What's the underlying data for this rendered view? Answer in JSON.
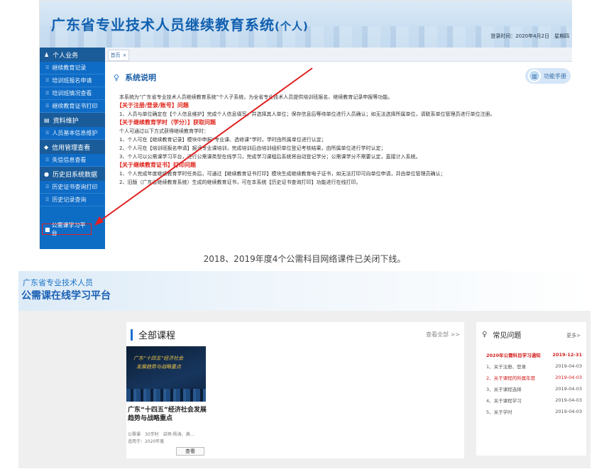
{
  "top": {
    "system_title_main": "广东省专业技术人员继续教育系统",
    "system_title_sub": "(个人)",
    "login_time": "登录时间：2020年4月2日　星期四",
    "sidebar": {
      "groups": [
        {
          "title": "个人业务",
          "items": [
            "继续教育记录",
            "培训班报名申请",
            "培训班情况查看",
            "继续教育证书打印"
          ]
        },
        {
          "title": "资料维护",
          "items": [
            "人员基本信息维护"
          ]
        },
        {
          "title": "信用管理查看",
          "items": [
            "失信信息查看"
          ]
        },
        {
          "title": "历史旧系统数据",
          "items": [
            "历史证书查询打印",
            "历史记录查询"
          ]
        }
      ],
      "highlighted_item": "公需课学习平台"
    },
    "tab_home": "首页",
    "tab_close": "×",
    "content_title": "系统说明",
    "manual_button": "功能手册",
    "intro": "本系统为“广东省专业技术人员继续教育系统”个人子系统，为全省专业技术人员提供培训班报名、继续教育记录申报等功能。",
    "sections": [
      {
        "title": "【关于注册/登录/账号】问题",
        "lines": [
          "1、人员与单位确定在【个人信息维护】完成个人信息填写，并选择其人单位；保存信息后等待单位进行人员确认；如无法选择所属单位，请联系单位管理员进行单位注册。"
        ]
      },
      {
        "title": "【关于继续教育学时（学分）】获取问题",
        "lines": [
          "个人可通过以下方式获得继续教育学时：",
          "1、个人可在【继续教育记录】模块中申报“专业课、选修课”学时，学时由所属单位进行认定；",
          "2、个人可在【培训班报名申请】报读专业课培训，完成培训后由培训组织单位登记考核结果，由所属单位进行学时认定；",
          "3、个人可以公需课学习平台，进行公需课类型在线学习，完成学习课程后系统将自动登记学分；公需课学分不需要认定，直接计入系统。"
        ]
      },
      {
        "title": "【关于继续教育证书】打印问题",
        "lines": [
          "1、个人完成年度继续教育学时任务后，可通过【继续教育证书打印】模块生成继续教育电子证书，如无法打印可向单位申请，并由单位管理员确认；",
          "2、旧版（广东省继续教育系统）生成的继续教育证书，可在本系统【历史证书查询打印】功能进行在线打印。"
        ]
      }
    ]
  },
  "caption": "2018、2019年度4个公需科目网络课件已关闭下线。",
  "bottom": {
    "platform_line1": "广东省专业技术人员",
    "platform_line2": "公需课在线学习平台",
    "courses_title": "全部课程",
    "view_all": "查看全部 >>",
    "course": {
      "thumb_line1": "广东“十四五”经济社会",
      "thumb_line2": "发展趋势与战略重点",
      "name": "广东“十四五”经济社会发展趋势与战略重点",
      "meta1": "公需课　30学时　讲师:杨涛、满…",
      "meta2": "适用于：2020年度",
      "button": "查看"
    },
    "faq_title": "常见问题",
    "faq_more": "更多>",
    "faq": [
      {
        "title": "2020年公需科目学习通知",
        "date": "2019-12-31",
        "highlight": true
      },
      {
        "title": "1、关于注册、登录",
        "date": "2019-04-03",
        "highlight": false
      },
      {
        "title": "2、关于课程的所属年度",
        "date": "2019-04-03",
        "highlight": true
      },
      {
        "title": "3、关于课程选择",
        "date": "2019-04-03",
        "highlight": false
      },
      {
        "title": "4、关于课程学习",
        "date": "2019-04-03",
        "highlight": false
      },
      {
        "title": "5、关于学时",
        "date": "2019-04-03",
        "highlight": false
      }
    ]
  },
  "colors": {
    "accent": "#1a6fd0",
    "sidebar": "#0f6cc6",
    "warning": "#e0251c"
  }
}
